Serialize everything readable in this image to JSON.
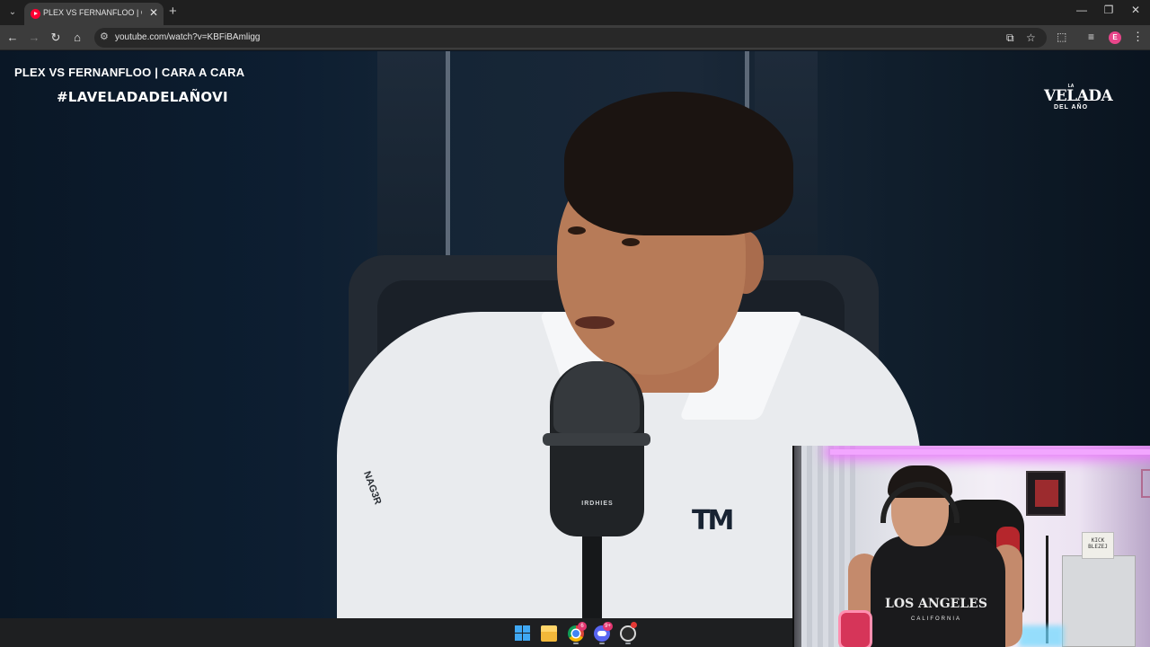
{
  "browser": {
    "tab": {
      "title": "PLEX VS FERNANFLOO | CARA A CARA - YouTube",
      "favicon": "youtube-icon",
      "close_glyph": "✕"
    },
    "new_tab_glyph": "+",
    "tab_search_glyph": "⌄",
    "window_controls": {
      "minimize": "—",
      "restore": "❐",
      "close": "✕"
    },
    "nav": {
      "back": "←",
      "forward": "→",
      "reload": "↻",
      "home": "⌂"
    },
    "omnibox": {
      "site_info_glyph": "⚙",
      "url": "youtube.com/watch?v=KBFiBAmligg",
      "install_glyph": "⧉",
      "bookmark_glyph": "☆"
    },
    "toolbar_icons": {
      "extensions": "⬚",
      "media": "≡",
      "menu": "⋮"
    },
    "profile_initial": "E"
  },
  "video": {
    "overlay_title": "PLEX VS FERNANFLOO | CARA A CARA",
    "hashtag": "#LAVELADADELAÑOVI",
    "brand_logo": {
      "top": "LA",
      "main": "VELADA",
      "sub": "DEL AÑO"
    },
    "mic_brand": "IRDHIES",
    "sleeve_text": "NAG3R"
  },
  "webcam": {
    "shirt_text": "LOS ANGELES",
    "shirt_subtext": "CALIFORNIA",
    "sign_text": "KICK BLEZEJ"
  },
  "taskbar": {
    "apps": [
      {
        "name": "start-button"
      },
      {
        "name": "file-explorer"
      },
      {
        "name": "chrome",
        "badge": "6"
      },
      {
        "name": "discord",
        "badge": "9+"
      },
      {
        "name": "obs",
        "badge": ""
      }
    ]
  },
  "colors": {
    "youtube_red": "#ff0033",
    "tab_bg": "#3c3c3c",
    "frame_bg": "#1f1f1f",
    "badge": "#e2356f"
  }
}
